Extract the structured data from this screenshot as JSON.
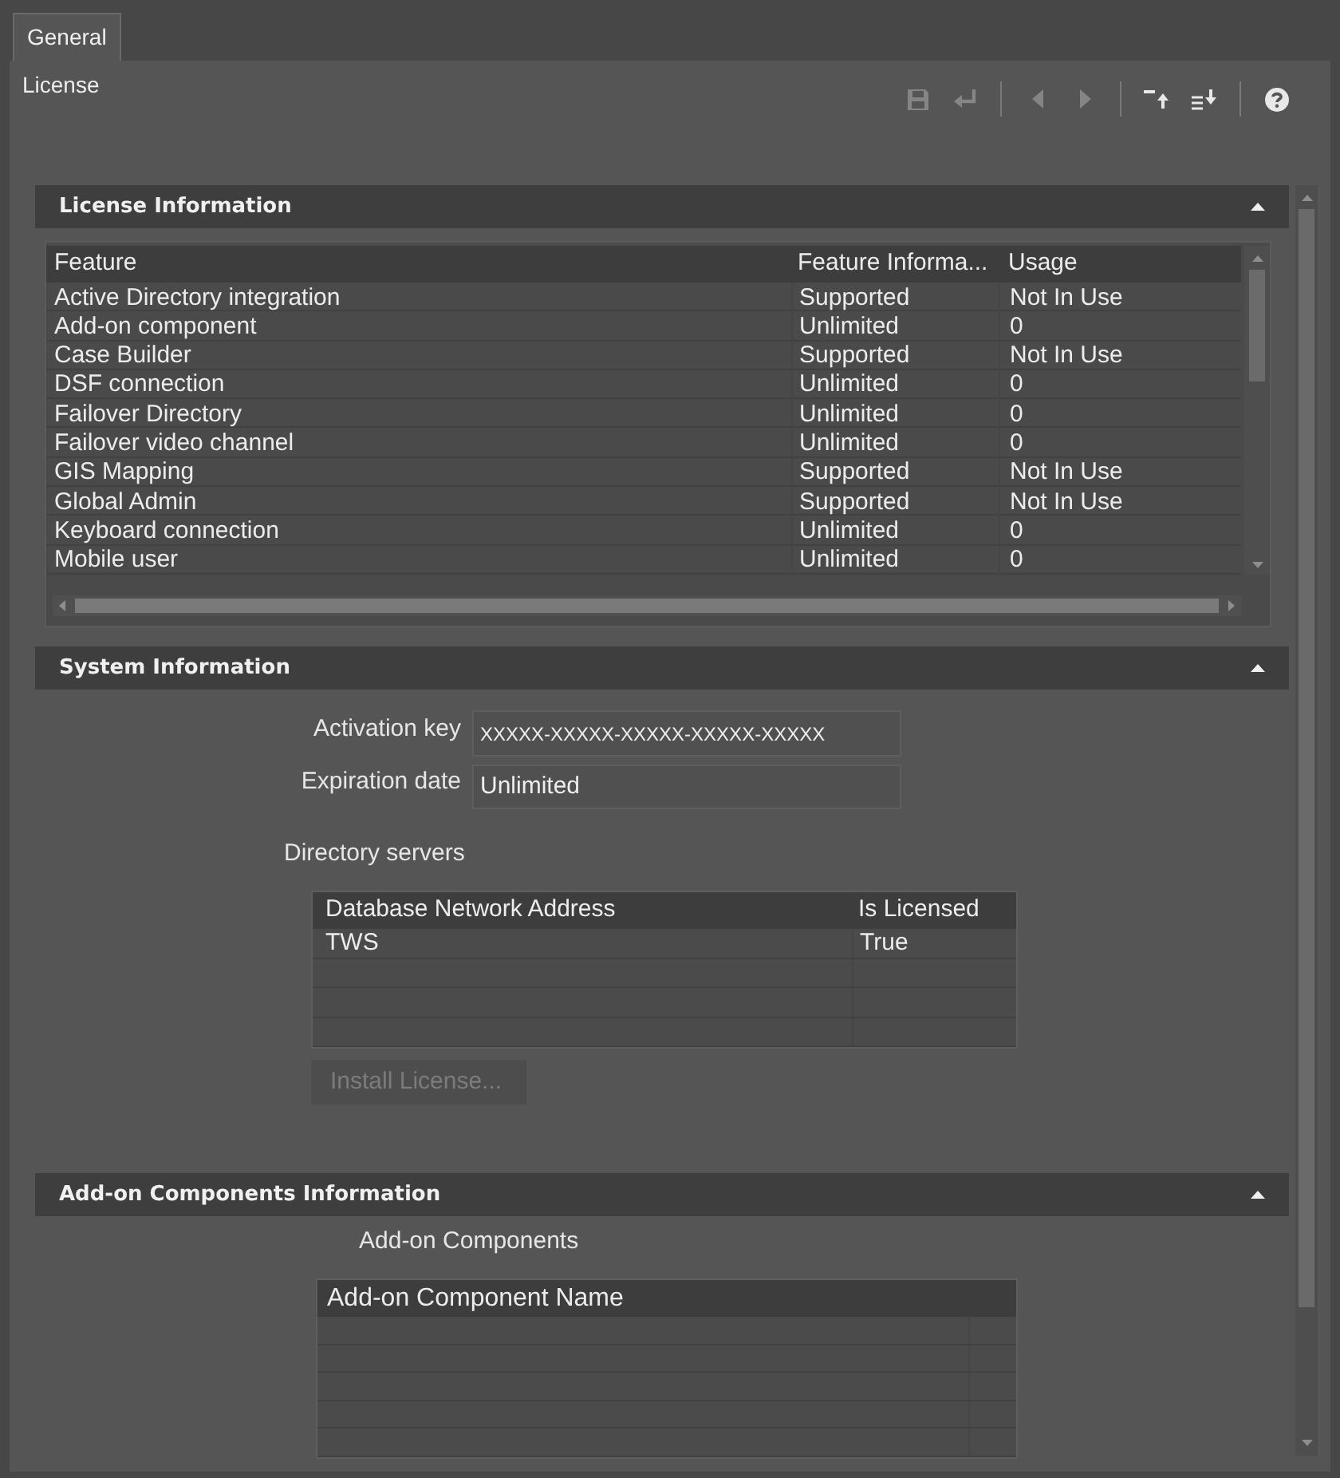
{
  "tabs": [
    {
      "label": "General",
      "selected": true
    }
  ],
  "page": {
    "title": "License"
  },
  "toolbar": [
    {
      "kind": "save",
      "disabled": true
    },
    {
      "kind": "undo",
      "disabled": true
    },
    {
      "kind": "separator"
    },
    {
      "kind": "previous",
      "disabled": true
    },
    {
      "kind": "next",
      "disabled": true
    },
    {
      "kind": "separator"
    },
    {
      "kind": "collapse_all",
      "disabled": false
    },
    {
      "kind": "expand_all",
      "disabled": false
    },
    {
      "kind": "separator"
    },
    {
      "kind": "help",
      "disabled": false
    }
  ],
  "license_information": {
    "title": "License Information",
    "expanded": true,
    "table": {
      "columns": [
        "Feature",
        "Feature Informa...",
        "Usage"
      ],
      "rows": [
        [
          "Active Directory integration",
          "Supported",
          "Not In Use"
        ],
        [
          "Add-on component",
          "Unlimited",
          "0"
        ],
        [
          "Case Builder",
          "Supported",
          "Not In Use"
        ],
        [
          "DSF connection",
          "Unlimited",
          "0"
        ],
        [
          "Failover Directory",
          "Unlimited",
          "0"
        ],
        [
          "Failover video channel",
          "Unlimited",
          "0"
        ],
        [
          "GIS Mapping",
          "Supported",
          "Not In Use"
        ],
        [
          "Global Admin",
          "Supported",
          "Not In Use"
        ],
        [
          "Keyboard connection",
          "Unlimited",
          "0"
        ],
        [
          "Mobile user",
          "Unlimited",
          "0"
        ]
      ]
    }
  },
  "system_information": {
    "title": "System Information",
    "expanded": true,
    "fields": [
      {
        "label": "Activation key",
        "value": "XXXXX-XXXXX-XXXXX-XXXXX-XXXXX"
      },
      {
        "label": "Expiration date",
        "value": "Unlimited"
      }
    ],
    "directory_servers": {
      "label": "Directory servers",
      "columns": [
        "Database Network Address",
        "Is Licensed"
      ],
      "rows": [
        [
          "TWS",
          "True"
        ]
      ]
    },
    "install_button": {
      "label": "Install License...",
      "disabled": true
    }
  },
  "add_on_components_information": {
    "title": "Add-on Components Information",
    "expanded": true,
    "label": "Add-on Components",
    "table": {
      "columns": [
        "Add-on Component Name"
      ]
    }
  }
}
